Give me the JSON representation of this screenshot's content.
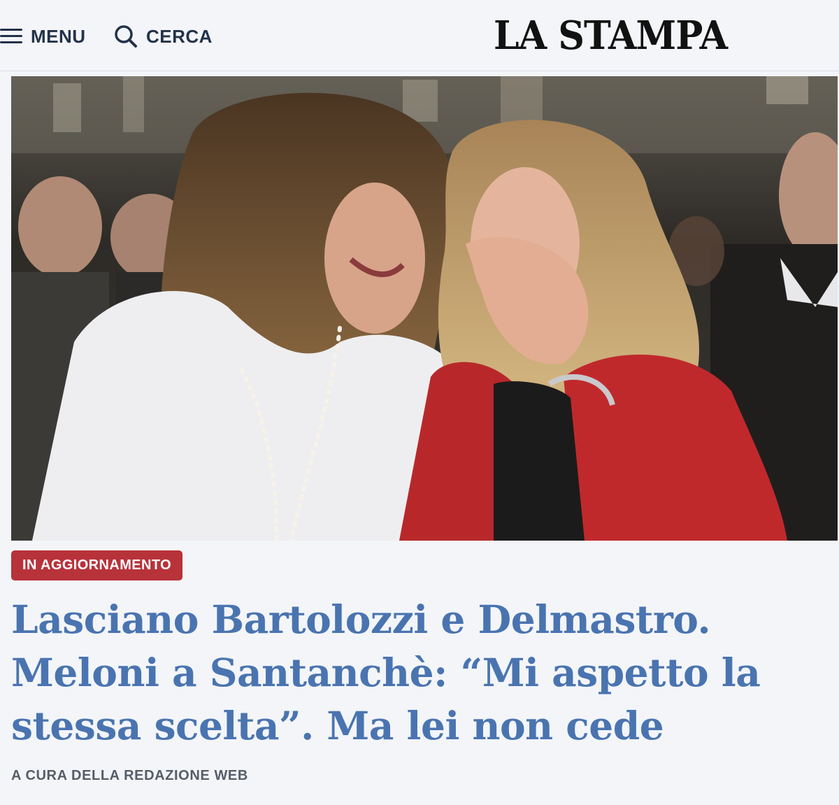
{
  "header": {
    "menu_label": "MENU",
    "search_label": "CERCA",
    "logo_text": "LA STAMPA"
  },
  "article": {
    "badge": "IN AGGIORNAMENTO",
    "headline": "Lasciano Bartolozzi e Delmastro. Meloni a Santanchè: “Mi aspetto la stessa scelta”. Ma lei non cede",
    "byline": "A CURA DELLA REDAZIONE WEB"
  },
  "colors": {
    "badge_bg": "#b8323a",
    "headline": "#4a74b0",
    "nav_text": "#233249",
    "page_bg": "#f3f5f8"
  },
  "icons": {
    "menu": "hamburger-icon",
    "search": "search-icon"
  }
}
